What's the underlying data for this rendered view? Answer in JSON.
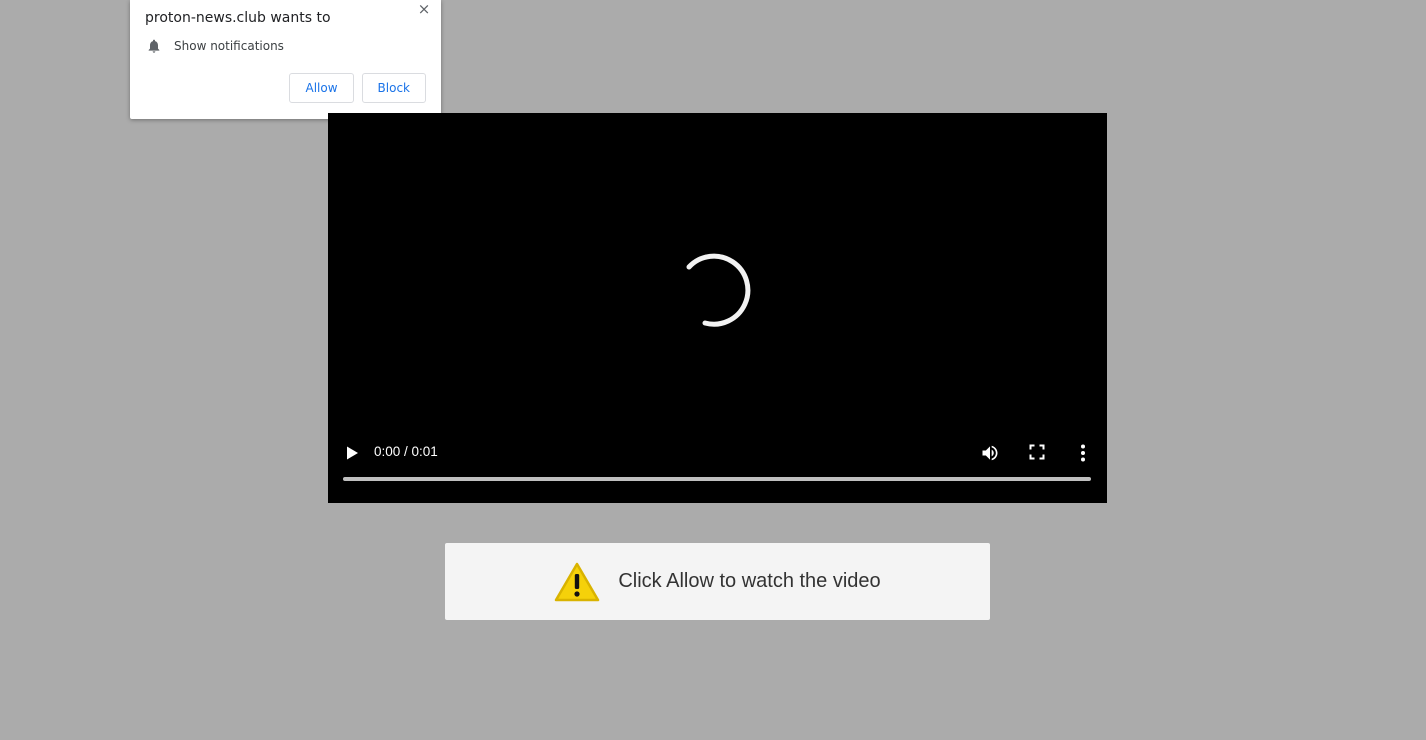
{
  "permission_popup": {
    "title": "proton-news.club wants to",
    "permission_label": "Show notifications",
    "allow_label": "Allow",
    "block_label": "Block",
    "close_glyph": "×",
    "icons": {
      "bell": "bell-icon",
      "close": "close-icon"
    },
    "accent_color": "#1a73e8"
  },
  "video": {
    "time_display": "0:00 / 0:01",
    "progress_percent": 0,
    "loading": true,
    "icons": {
      "play": "play-icon",
      "volume": "volume-icon",
      "fullscreen": "fullscreen-icon",
      "more": "more-vert-icon",
      "spinner": "loading-spinner"
    }
  },
  "warning": {
    "message": "Click Allow to watch the video",
    "icon": "warning-triangle-icon",
    "icon_color": "#f5d10a"
  },
  "colors": {
    "page_background": "#ababab",
    "player_background": "#000000",
    "warning_box_background": "#f4f4f4"
  }
}
